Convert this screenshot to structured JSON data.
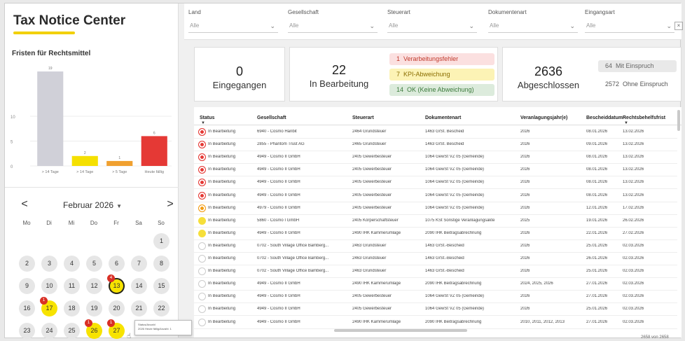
{
  "app": {
    "title": "Tax Notice Center"
  },
  "fristen": {
    "title": "Fristen für Rechtsmittel",
    "chart_data": {
      "type": "bar",
      "categories": [
        "> 14 Tage",
        "> 14 Tage",
        "> 5 Tage",
        "Heute fällig"
      ],
      "values": [
        19,
        2,
        1,
        6
      ],
      "colors": [
        "#d0d0d8",
        "#f5e000",
        "#f0a030",
        "#e53935"
      ],
      "ylim": [
        0,
        20
      ],
      "yticks": [
        0,
        5,
        10
      ],
      "grid": true
    }
  },
  "calendar": {
    "prev": "<",
    "next": ">",
    "month_label": "Februar 2026",
    "weekdays": [
      "Mo",
      "Di",
      "Mi",
      "Do",
      "Fr",
      "Sa",
      "So"
    ],
    "days": [
      {
        "d": "1",
        "col": 6,
        "row": 0
      },
      {
        "d": "2",
        "col": 0,
        "row": 1
      },
      {
        "d": "3",
        "col": 1,
        "row": 1
      },
      {
        "d": "4",
        "col": 2,
        "row": 1
      },
      {
        "d": "5",
        "col": 3,
        "row": 1
      },
      {
        "d": "6",
        "col": 4,
        "row": 1
      },
      {
        "d": "7",
        "col": 5,
        "row": 1
      },
      {
        "d": "8",
        "col": 6,
        "row": 1
      },
      {
        "d": "9",
        "col": 0,
        "row": 2
      },
      {
        "d": "10",
        "col": 1,
        "row": 2
      },
      {
        "d": "11",
        "col": 2,
        "row": 2
      },
      {
        "d": "12",
        "col": 3,
        "row": 2
      },
      {
        "d": "13",
        "col": 4,
        "row": 2,
        "state": "sel",
        "badge": "4"
      },
      {
        "d": "14",
        "col": 5,
        "row": 2
      },
      {
        "d": "15",
        "col": 6,
        "row": 2
      },
      {
        "d": "16",
        "col": 0,
        "row": 3
      },
      {
        "d": "17",
        "col": 1,
        "row": 3,
        "state": "hl",
        "badge": "1"
      },
      {
        "d": "18",
        "col": 2,
        "row": 3
      },
      {
        "d": "19",
        "col": 3,
        "row": 3
      },
      {
        "d": "20",
        "col": 4,
        "row": 3
      },
      {
        "d": "21",
        "col": 5,
        "row": 3
      },
      {
        "d": "22",
        "col": 6,
        "row": 3
      },
      {
        "d": "23",
        "col": 0,
        "row": 4
      },
      {
        "d": "24",
        "col": 1,
        "row": 4
      },
      {
        "d": "25",
        "col": 2,
        "row": 4
      },
      {
        "d": "26",
        "col": 3,
        "row": 4,
        "state": "hl",
        "badge": "1"
      },
      {
        "d": "27",
        "col": 4,
        "row": 4,
        "state": "hl",
        "badge": "1"
      }
    ],
    "tooltip_line1": "Status/Anzahl",
    "tooltip_line2": "2026 Heute fällig/Anzahl: 1"
  },
  "filters": [
    {
      "label": "Land",
      "value": "Alle"
    },
    {
      "label": "Gesellschaft",
      "value": "Alle"
    },
    {
      "label": "Steuerart",
      "value": "Alle"
    },
    {
      "label": "Dokumentenart",
      "value": "Alle"
    },
    {
      "label": "Eingangsart",
      "value": "Alle"
    }
  ],
  "kpis": {
    "eingegangen": {
      "num": "0",
      "label": "Eingegangen"
    },
    "bearbeitung": {
      "num": "22",
      "label": "In Bearbeitung",
      "chips": [
        {
          "n": "1",
          "t": "Verarbeitungsfehler"
        },
        {
          "n": "7",
          "t": "KPI-Abweichung"
        },
        {
          "n": "14",
          "t": "OK (Keine Abweichung)"
        }
      ]
    },
    "abgeschlossen": {
      "num": "2636",
      "label": "Abgeschlossen",
      "chips": [
        {
          "n": "64",
          "t": "Mit Einspruch"
        },
        {
          "n": "2572",
          "t": "Ohne Einspruch"
        }
      ]
    }
  },
  "table": {
    "columns": [
      "Status",
      "Gesellschaft",
      "Steuerart",
      "Dokumentenart",
      "Veranlagungsjahr(e)",
      "Bescheiddatum",
      "Rechtsbehelfsfrist"
    ],
    "rows": [
      {
        "dot": "red",
        "c": [
          "In Bearbeitung",
          "6940 - Cosmo Hanbit",
          "2464 Grundsteuer",
          "1463 GrSt. Bescheid",
          "2026",
          "08.01.2026",
          "13.02.2026"
        ]
      },
      {
        "dot": "red",
        "c": [
          "In Bearbeitung",
          "2855 - Phantom Trust AG",
          "2465 Grundsteuer",
          "1463 GrSt. Bescheid",
          "2026",
          "09.01.2026",
          "13.02.2026"
        ]
      },
      {
        "dot": "red",
        "c": [
          "In Bearbeitung",
          "4949 - Cosmo II GmbH",
          "2405 Gewerbesteuer",
          "1064 GewSt VZ 05 (Gemeinde)",
          "2026",
          "08.01.2026",
          "13.02.2026"
        ]
      },
      {
        "dot": "red",
        "c": [
          "In Bearbeitung",
          "4949 - Cosmo II GmbH",
          "2405 Gewerbesteuer",
          "1064 GewSt VZ 05 (Gemeinde)",
          "2026",
          "08.01.2026",
          "13.02.2026"
        ]
      },
      {
        "dot": "red",
        "c": [
          "In Bearbeitung",
          "4949 - Cosmo II GmbH",
          "2405 Gewerbesteuer",
          "1064 GewSt VZ 05 (Gemeinde)",
          "2026",
          "08.01.2026",
          "13.02.2026"
        ]
      },
      {
        "dot": "red",
        "c": [
          "In Bearbeitung",
          "4949 - Cosmo II GmbH",
          "2405 Gewerbesteuer",
          "1064 GewSt VZ 05 (Gemeinde)",
          "2026",
          "08.01.2026",
          "13.02.2026"
        ]
      },
      {
        "dot": "orange",
        "c": [
          "In Bearbeitung",
          "4979 - Cosmo II GmbH",
          "2405 Gewerbesteuer",
          "1064 GewSt VZ 05 (Gemeinde)",
          "2026",
          "12.01.2026",
          "17.02.2026"
        ]
      },
      {
        "dot": "yellow",
        "c": [
          "In Bearbeitung",
          "5860 - Cosmo I GmbH",
          "2405 Körperschaftsteuer",
          "1075 KSt Sonstige Veranlagungsakte",
          "2025",
          "19.01.2026",
          "26.02.2026"
        ]
      },
      {
        "dot": "yellow",
        "c": [
          "In Bearbeitung",
          "4949 - Cosmo II GmbH",
          "2490 IHK Kammerumlage",
          "2090 IHK Beitragsabrechnung",
          "2026",
          "22.01.2026",
          "27.02.2026"
        ]
      },
      {
        "dot": "empty",
        "c": [
          "In Bearbeitung",
          "0702 - South Village Office Bamberg...",
          "2463 Grundsteuer",
          "1463 GrSt.-Bescheid",
          "2026",
          "25.01.2026",
          "02.03.2026"
        ]
      },
      {
        "dot": "empty",
        "c": [
          "In Bearbeitung",
          "0702 - South Village Office Bamberg...",
          "2463 Grundsteuer",
          "1463 GrSt.-Bescheid",
          "2026",
          "26.01.2026",
          "02.03.2026"
        ]
      },
      {
        "dot": "empty",
        "c": [
          "In Bearbeitung",
          "0702 - South Village Office Bamberg...",
          "2463 Grundsteuer",
          "1463 GrSt.-Bescheid",
          "2026",
          "25.01.2026",
          "02.03.2026"
        ]
      },
      {
        "dot": "empty",
        "c": [
          "In Bearbeitung",
          "4949 - Cosmo II GmbH",
          "2490 IHK Kammerumlage",
          "2090 IHK Beitragsabrechnung",
          "2024, 2025, 2026",
          "27.01.2026",
          "02.03.2026"
        ]
      },
      {
        "dot": "empty",
        "c": [
          "In Bearbeitung",
          "4949 - Cosmo II GmbH",
          "2405 Gewerbesteuer",
          "1064 GewSt VZ 05 (Gemeinde)",
          "2026",
          "27.01.2026",
          "02.03.2026"
        ]
      },
      {
        "dot": "empty",
        "c": [
          "In Bearbeitung",
          "4949 - Cosmo II GmbH",
          "2405 Gewerbesteuer",
          "1064 GewSt VZ 05 (Gemeinde)",
          "2026",
          "25.01.2026",
          "02.03.2026"
        ]
      },
      {
        "dot": "empty",
        "c": [
          "In Bearbeitung",
          "4949 - Cosmo II GmbH",
          "2490 IHK Kammerumlage",
          "2090 IHK Beitragsabrechnung",
          "2010, 2011, 2012, 2013",
          "27.01.2026",
          "02.03.2026"
        ]
      }
    ],
    "paging": "2658 von 2658"
  }
}
